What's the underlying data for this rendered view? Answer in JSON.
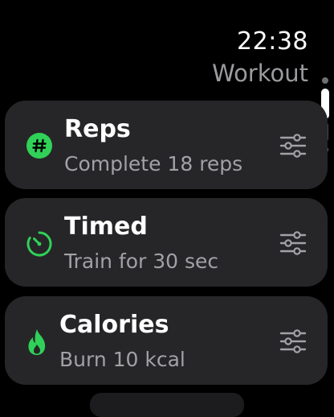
{
  "status": {
    "time": "22:38"
  },
  "header": {
    "title": "Workout"
  },
  "goals": [
    {
      "title": "Reps",
      "subtitle": "Complete 18 reps",
      "icon": "hash-icon"
    },
    {
      "title": "Timed",
      "subtitle": "Train for 30 sec",
      "icon": "timer-icon"
    },
    {
      "title": "Calories",
      "subtitle": "Burn 10 kcal",
      "icon": "flame-icon"
    }
  ],
  "colors": {
    "accent": "#30d158",
    "card_bg": "#262628",
    "subtitle": "#a1a1a6",
    "title_gray": "#9b9b9f"
  }
}
